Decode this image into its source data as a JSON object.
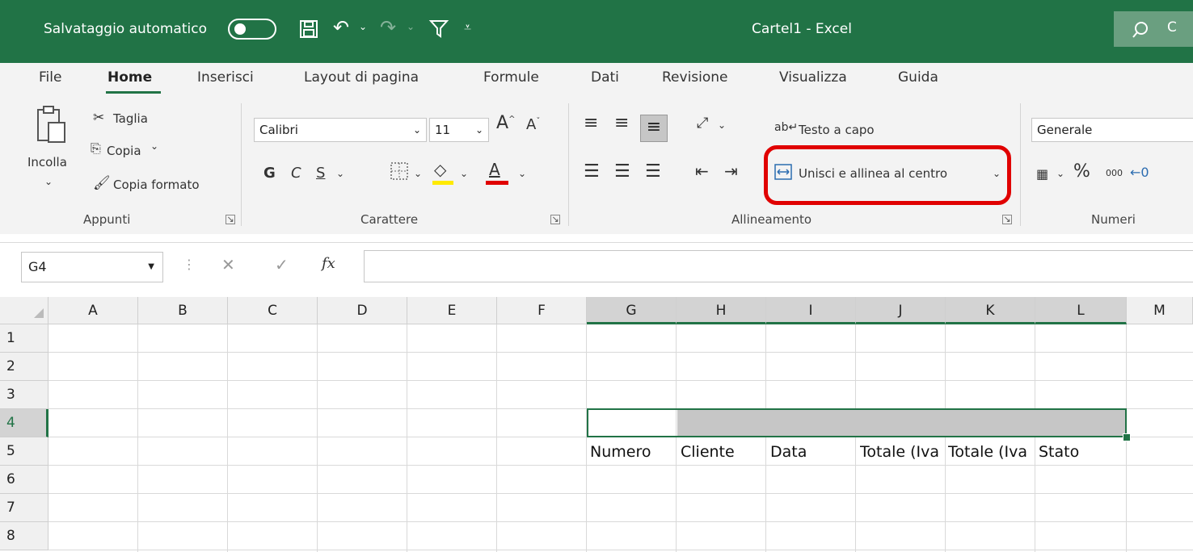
{
  "titlebar": {
    "autosave_label": "Salvataggio automatico",
    "doc_title": "Cartel1 - Excel",
    "search_icon": "search-icon"
  },
  "tabs": [
    "File",
    "Home",
    "Inserisci",
    "Layout di pagina",
    "Formule",
    "Dati",
    "Revisione",
    "Visualizza",
    "Guida"
  ],
  "clipboard": {
    "paste": "Incolla",
    "cut": "Taglia",
    "copy": "Copia",
    "format_painter": "Copia formato",
    "group": "Appunti"
  },
  "font": {
    "name": "Calibri",
    "size": "11",
    "bold": "G",
    "italic": "C",
    "underline": "S",
    "group": "Carattere"
  },
  "alignment": {
    "wrap_text": "Testo a capo",
    "merge_center": "Unisci e allinea al centro",
    "group": "Allineamento"
  },
  "number": {
    "format": "Generale",
    "percent": "%",
    "thousands": "000",
    "group": "Numeri"
  },
  "formula_bar": {
    "name_box": "G4",
    "fx": "fx",
    "value": ""
  },
  "columns": [
    "A",
    "B",
    "C",
    "D",
    "E",
    "F",
    "G",
    "H",
    "I",
    "J",
    "K",
    "L",
    "M"
  ],
  "rows": [
    "1",
    "2",
    "3",
    "4",
    "5",
    "6",
    "7",
    "8"
  ],
  "row5": [
    "Numero",
    "Cliente",
    "Data",
    "Totale (Iva",
    "Totale (Iva",
    "Stato"
  ],
  "colors": {
    "excel_green": "#217346",
    "highlight_red": "#e00000"
  }
}
